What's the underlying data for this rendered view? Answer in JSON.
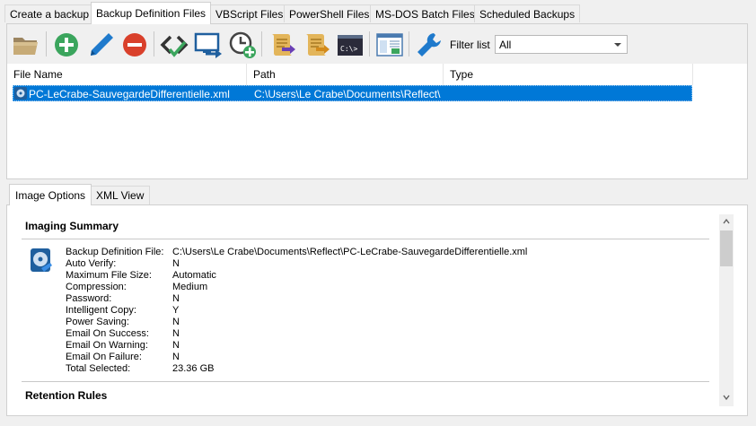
{
  "tabs": [
    {
      "label": "Create a backup"
    },
    {
      "label": "Backup Definition Files"
    },
    {
      "label": "VBScript Files"
    },
    {
      "label": "PowerShell Files"
    },
    {
      "label": "MS-DOS Batch Files"
    },
    {
      "label": "Scheduled Backups"
    }
  ],
  "toolbar": {
    "buttons": [
      {
        "icon": "open-folder-icon"
      },
      {
        "icon": "add-icon"
      },
      {
        "icon": "edit-pencil-icon"
      },
      {
        "icon": "remove-icon"
      },
      {
        "icon": "validate-xml-icon"
      },
      {
        "icon": "run-now-icon"
      },
      {
        "icon": "schedule-add-icon"
      },
      {
        "icon": "generate-vbscript-icon"
      },
      {
        "icon": "generate-powershell-icon"
      },
      {
        "icon": "generate-batch-icon"
      },
      {
        "icon": "window-view-icon"
      },
      {
        "icon": "settings-wrench-icon"
      }
    ],
    "batch_icon_text": "C:\\>",
    "filter_label": "Filter list",
    "filter_value": "All"
  },
  "file_list": {
    "columns": [
      "File Name",
      "Path",
      "Type"
    ],
    "rows": [
      {
        "name": "PC-LeCrabe-SauvegardeDifferentielle.xml",
        "path": "C:\\Users\\Le Crabe\\Documents\\Reflect\\",
        "type": ""
      }
    ]
  },
  "bottom_tabs": [
    {
      "label": "Image Options"
    },
    {
      "label": "XML View"
    }
  ],
  "summary": {
    "title": "Imaging Summary",
    "properties": [
      {
        "label": "Backup Definition File:",
        "value": "C:\\Users\\Le Crabe\\Documents\\Reflect\\PC-LeCrabe-SauvegardeDifferentielle.xml"
      },
      {
        "label": "Auto Verify:",
        "value": "N"
      },
      {
        "label": "Maximum File Size:",
        "value": "Automatic"
      },
      {
        "label": "Compression:",
        "value": "Medium"
      },
      {
        "label": "Password:",
        "value": "N"
      },
      {
        "label": "Intelligent Copy:",
        "value": "Y"
      },
      {
        "label": "Power Saving:",
        "value": "N"
      },
      {
        "label": "Email On Success:",
        "value": "N"
      },
      {
        "label": "Email On Warning:",
        "value": "N"
      },
      {
        "label": "Email On Failure:",
        "value": "N"
      },
      {
        "label": "Total Selected:",
        "value": "23.36 GB"
      }
    ],
    "retention_title": "Retention Rules"
  },
  "colors": {
    "selection": "#0078d7",
    "add": "#3ba55d",
    "remove": "#d9402b",
    "edit": "#1f7acc"
  }
}
